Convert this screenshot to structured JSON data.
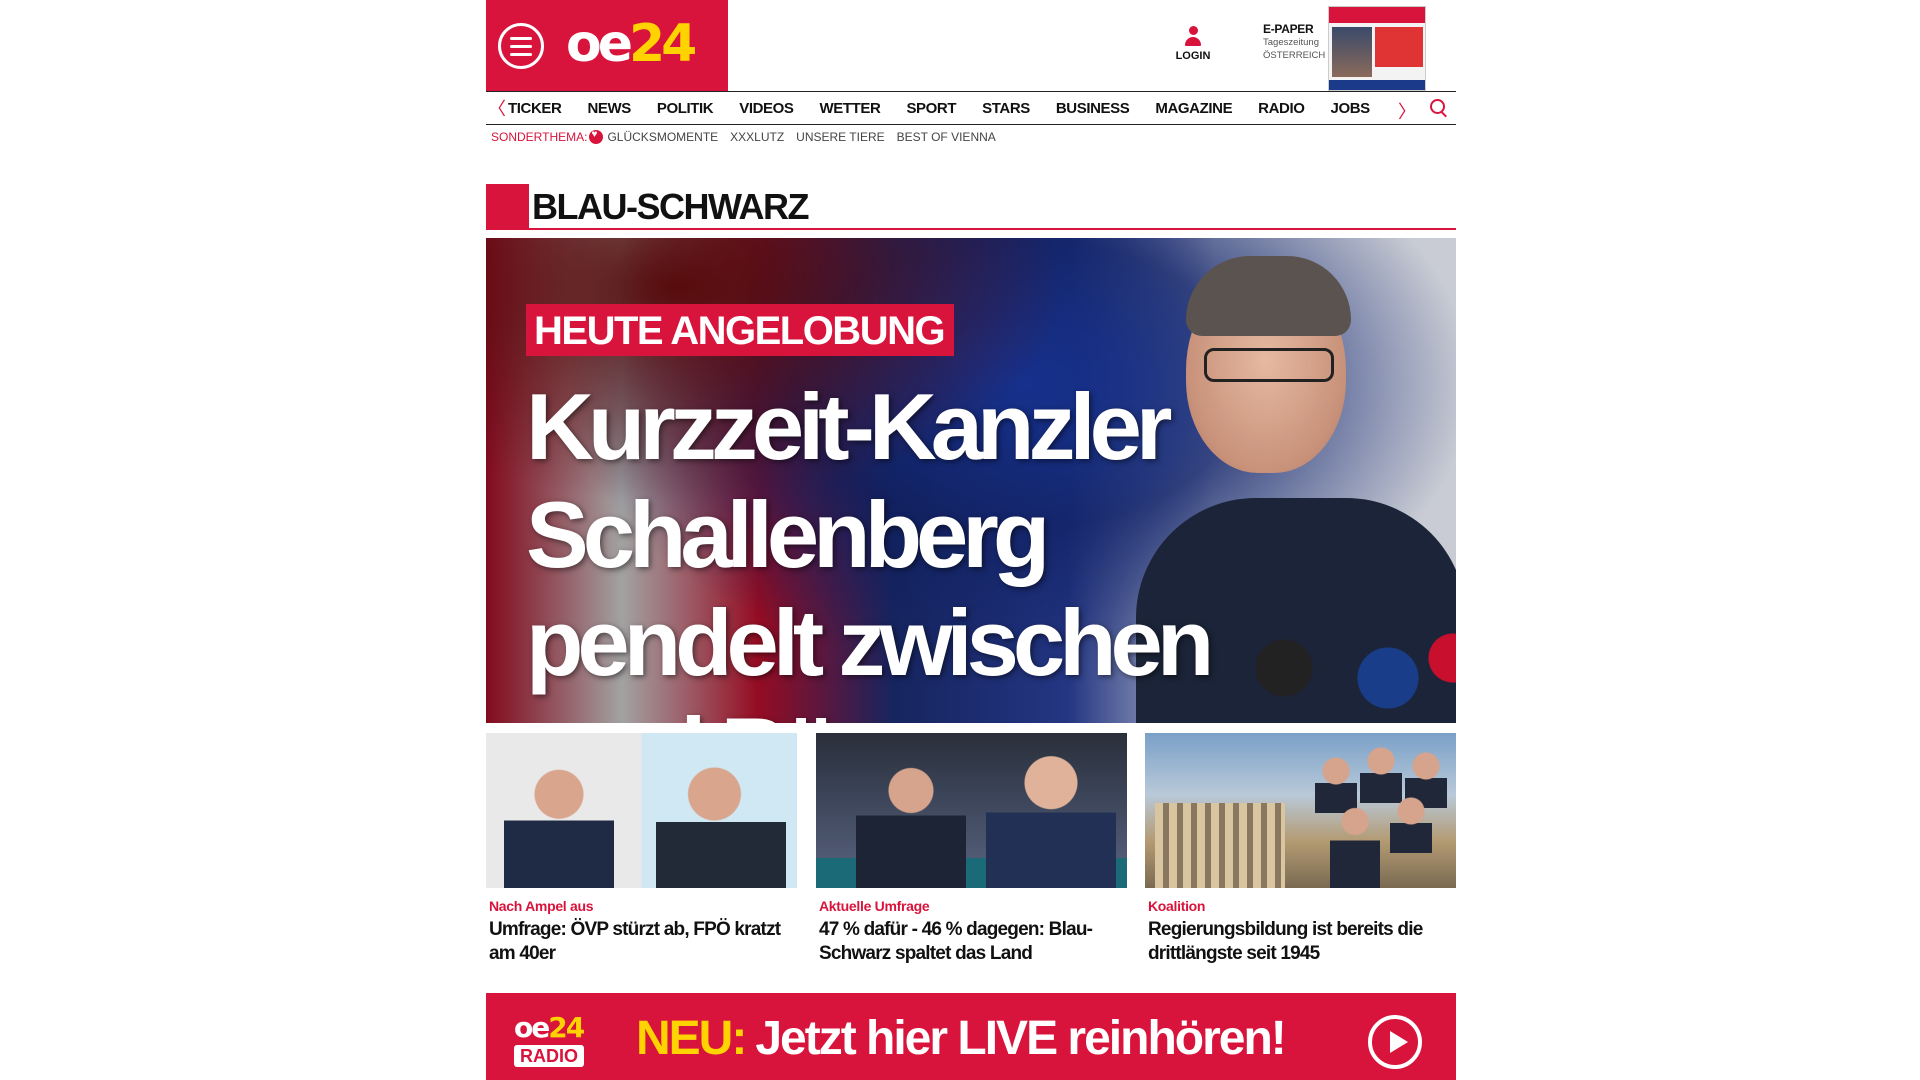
{
  "header": {
    "logo_oe": "oe",
    "logo_24": "24",
    "login_label": "LOGIN",
    "epaper_title": "E-PAPER",
    "epaper_sub1": "Tageszeitung",
    "epaper_sub2": "ÖSTERREICH"
  },
  "nav": {
    "items": [
      "TICKER",
      "NEWS",
      "POLITIK",
      "VIDEOS",
      "WETTER",
      "SPORT",
      "STARS",
      "BUSINESS",
      "MAGAZINE",
      "RADIO",
      "JOBS"
    ]
  },
  "subnav": {
    "label": "SONDERTHEMA:",
    "items": [
      "GLÜCKSMOMENTE",
      "XXXLUTZ",
      "UNSERE TIERE",
      "BEST OF VIENNA"
    ]
  },
  "section": {
    "title": "BLAU-SCHWARZ"
  },
  "hero": {
    "kicker": "HEUTE ANGELOBUNG",
    "headline": "Kurzzeit-Kanzler Schallenberg pendelt zwischen zwei Büros"
  },
  "teasers": [
    {
      "kicker": "Nach Ampel aus",
      "title": "Umfrage: ÖVP stürzt ab, FPÖ kratzt am 40er"
    },
    {
      "kicker": "Aktuelle Umfrage",
      "title": "47 % dafür - 46 % dagegen: Blau-Schwarz spaltet das Land"
    },
    {
      "kicker": "Koalition",
      "title": "Regierungsbildung ist bereits die drittlängste seit 1945"
    }
  ],
  "radio": {
    "logo_oe": "oe",
    "logo_24": "24",
    "logo_radio": "RADIO",
    "neu": "NEU:",
    "text": "Jetzt hier LIVE reinhören!"
  },
  "colors": {
    "brand_red": "#d8143c",
    "brand_yellow": "#ffd300"
  }
}
